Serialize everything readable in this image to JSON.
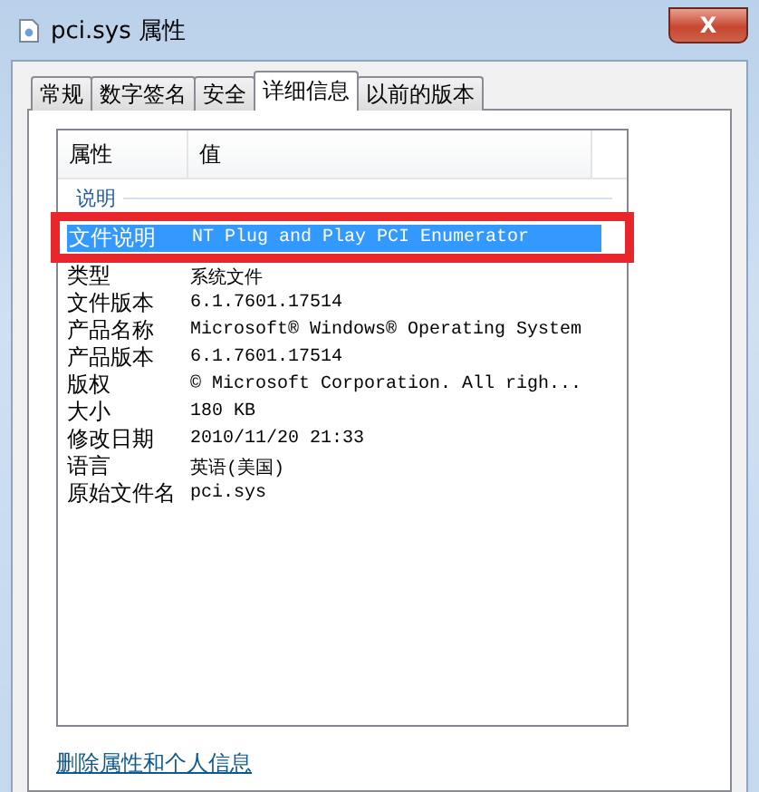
{
  "window": {
    "title": "pci.sys 属性",
    "close": "X"
  },
  "tabs": [
    {
      "label": "常规",
      "selected": false
    },
    {
      "label": "数字签名",
      "selected": false
    },
    {
      "label": "安全",
      "selected": false
    },
    {
      "label": "详细信息",
      "selected": true
    },
    {
      "label": "以前的版本",
      "selected": false
    }
  ],
  "table": {
    "columns": [
      "属性",
      "值"
    ],
    "groups": [
      {
        "title": "说明",
        "rows": [
          {
            "name": "文件说明",
            "value": "NT Plug and Play PCI Enumerator",
            "selected": true,
            "highlighted": true
          },
          {
            "name": "类型",
            "value": "系统文件",
            "selected": false,
            "highlighted": false
          },
          {
            "name": "文件版本",
            "value": "6.1.7601.17514",
            "selected": false,
            "highlighted": false
          },
          {
            "name": "产品名称",
            "value": "Microsoft® Windows® Operating System",
            "selected": false,
            "highlighted": false
          },
          {
            "name": "产品版本",
            "value": "6.1.7601.17514",
            "selected": false,
            "highlighted": false
          },
          {
            "name": "版权",
            "value": "© Microsoft Corporation. All righ...",
            "selected": false,
            "highlighted": false
          },
          {
            "name": "大小",
            "value": "180 KB",
            "selected": false,
            "highlighted": false
          },
          {
            "name": "修改日期",
            "value": "2010/11/20 21:33",
            "selected": false,
            "highlighted": false
          },
          {
            "name": "语言",
            "value": "英语(美国)",
            "selected": false,
            "highlighted": false
          },
          {
            "name": "原始文件名",
            "value": "pci.sys",
            "selected": false,
            "highlighted": false
          }
        ]
      }
    ]
  },
  "link": "删除属性和个人信息"
}
